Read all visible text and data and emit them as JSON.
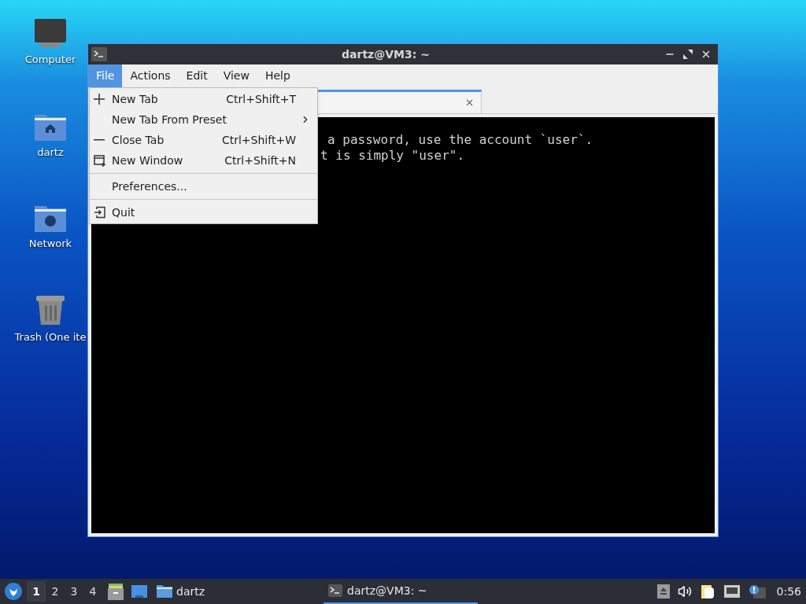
{
  "desktop_icons": [
    {
      "label": "Computer",
      "kind": "computer"
    },
    {
      "label": "dartz",
      "kind": "home"
    },
    {
      "label": "Network",
      "kind": "network"
    },
    {
      "label": "Trash (One ite",
      "kind": "trash"
    }
  ],
  "window": {
    "title": "dartz@VM3: ~",
    "menu": [
      {
        "label": "File",
        "selected": true
      },
      {
        "label": "Actions",
        "selected": false
      },
      {
        "label": "Edit",
        "selected": false
      },
      {
        "label": "View",
        "selected": false
      },
      {
        "label": "Help",
        "selected": false
      }
    ],
    "terminal_lines": [
      "a password, use the account `user`.",
      "t is simply \"user\"."
    ]
  },
  "file_menu": [
    {
      "kind": "new-tab",
      "label": "New Tab",
      "shortcut": "Ctrl+Shift+T"
    },
    {
      "kind": "submenu",
      "label": "New Tab From Preset"
    },
    {
      "kind": "close-tab",
      "label": "Close Tab",
      "shortcut": "Ctrl+Shift+W"
    },
    {
      "kind": "new-window",
      "label": "New Window",
      "shortcut": "Ctrl+Shift+N"
    },
    {
      "kind": "separator"
    },
    {
      "kind": "plain",
      "label": "Preferences..."
    },
    {
      "kind": "separator"
    },
    {
      "kind": "quit",
      "label": "Quit"
    }
  ],
  "taskbar": {
    "workspaces": [
      {
        "label": "1",
        "selected": true
      },
      {
        "label": "2",
        "selected": false
      },
      {
        "label": "3",
        "selected": false
      },
      {
        "label": "4",
        "selected": false
      }
    ],
    "launchers": [
      {
        "kind": "files"
      },
      {
        "kind": "desktop"
      },
      {
        "kind": "folder",
        "label": "dartz"
      }
    ],
    "tasks": [
      {
        "label": "dartz@VM3: ~",
        "selected": true
      }
    ],
    "tray": [
      {
        "kind": "eject"
      },
      {
        "kind": "volume"
      },
      {
        "kind": "clipboard"
      },
      {
        "kind": "network"
      },
      {
        "kind": "notification"
      }
    ],
    "clock": "0:56"
  }
}
